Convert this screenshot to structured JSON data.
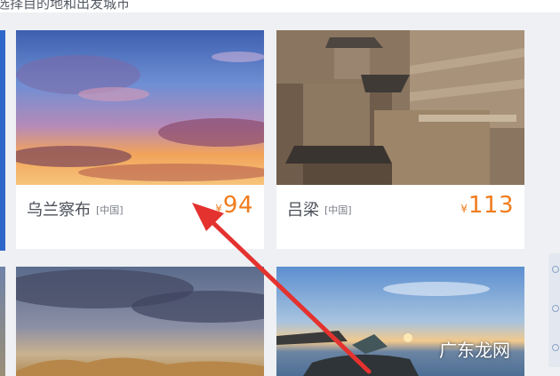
{
  "header": {
    "partial_text": "选择目的地和出发城市"
  },
  "destinations": [
    {
      "city": "乌兰察布",
      "country": "[中国]",
      "currency": "¥",
      "price": "94"
    },
    {
      "city": "吕梁",
      "country": "[中国]",
      "currency": "¥",
      "price": "113"
    },
    {
      "city": "",
      "country": "",
      "currency": "",
      "price": ""
    },
    {
      "city": "",
      "country": "",
      "currency": "",
      "price": ""
    }
  ],
  "watermark": "广东龙网",
  "colors": {
    "price": "#f07c1e",
    "arrow": "#e4322f",
    "card_bg": "#ffffff",
    "page_bg": "#eef0f3"
  }
}
